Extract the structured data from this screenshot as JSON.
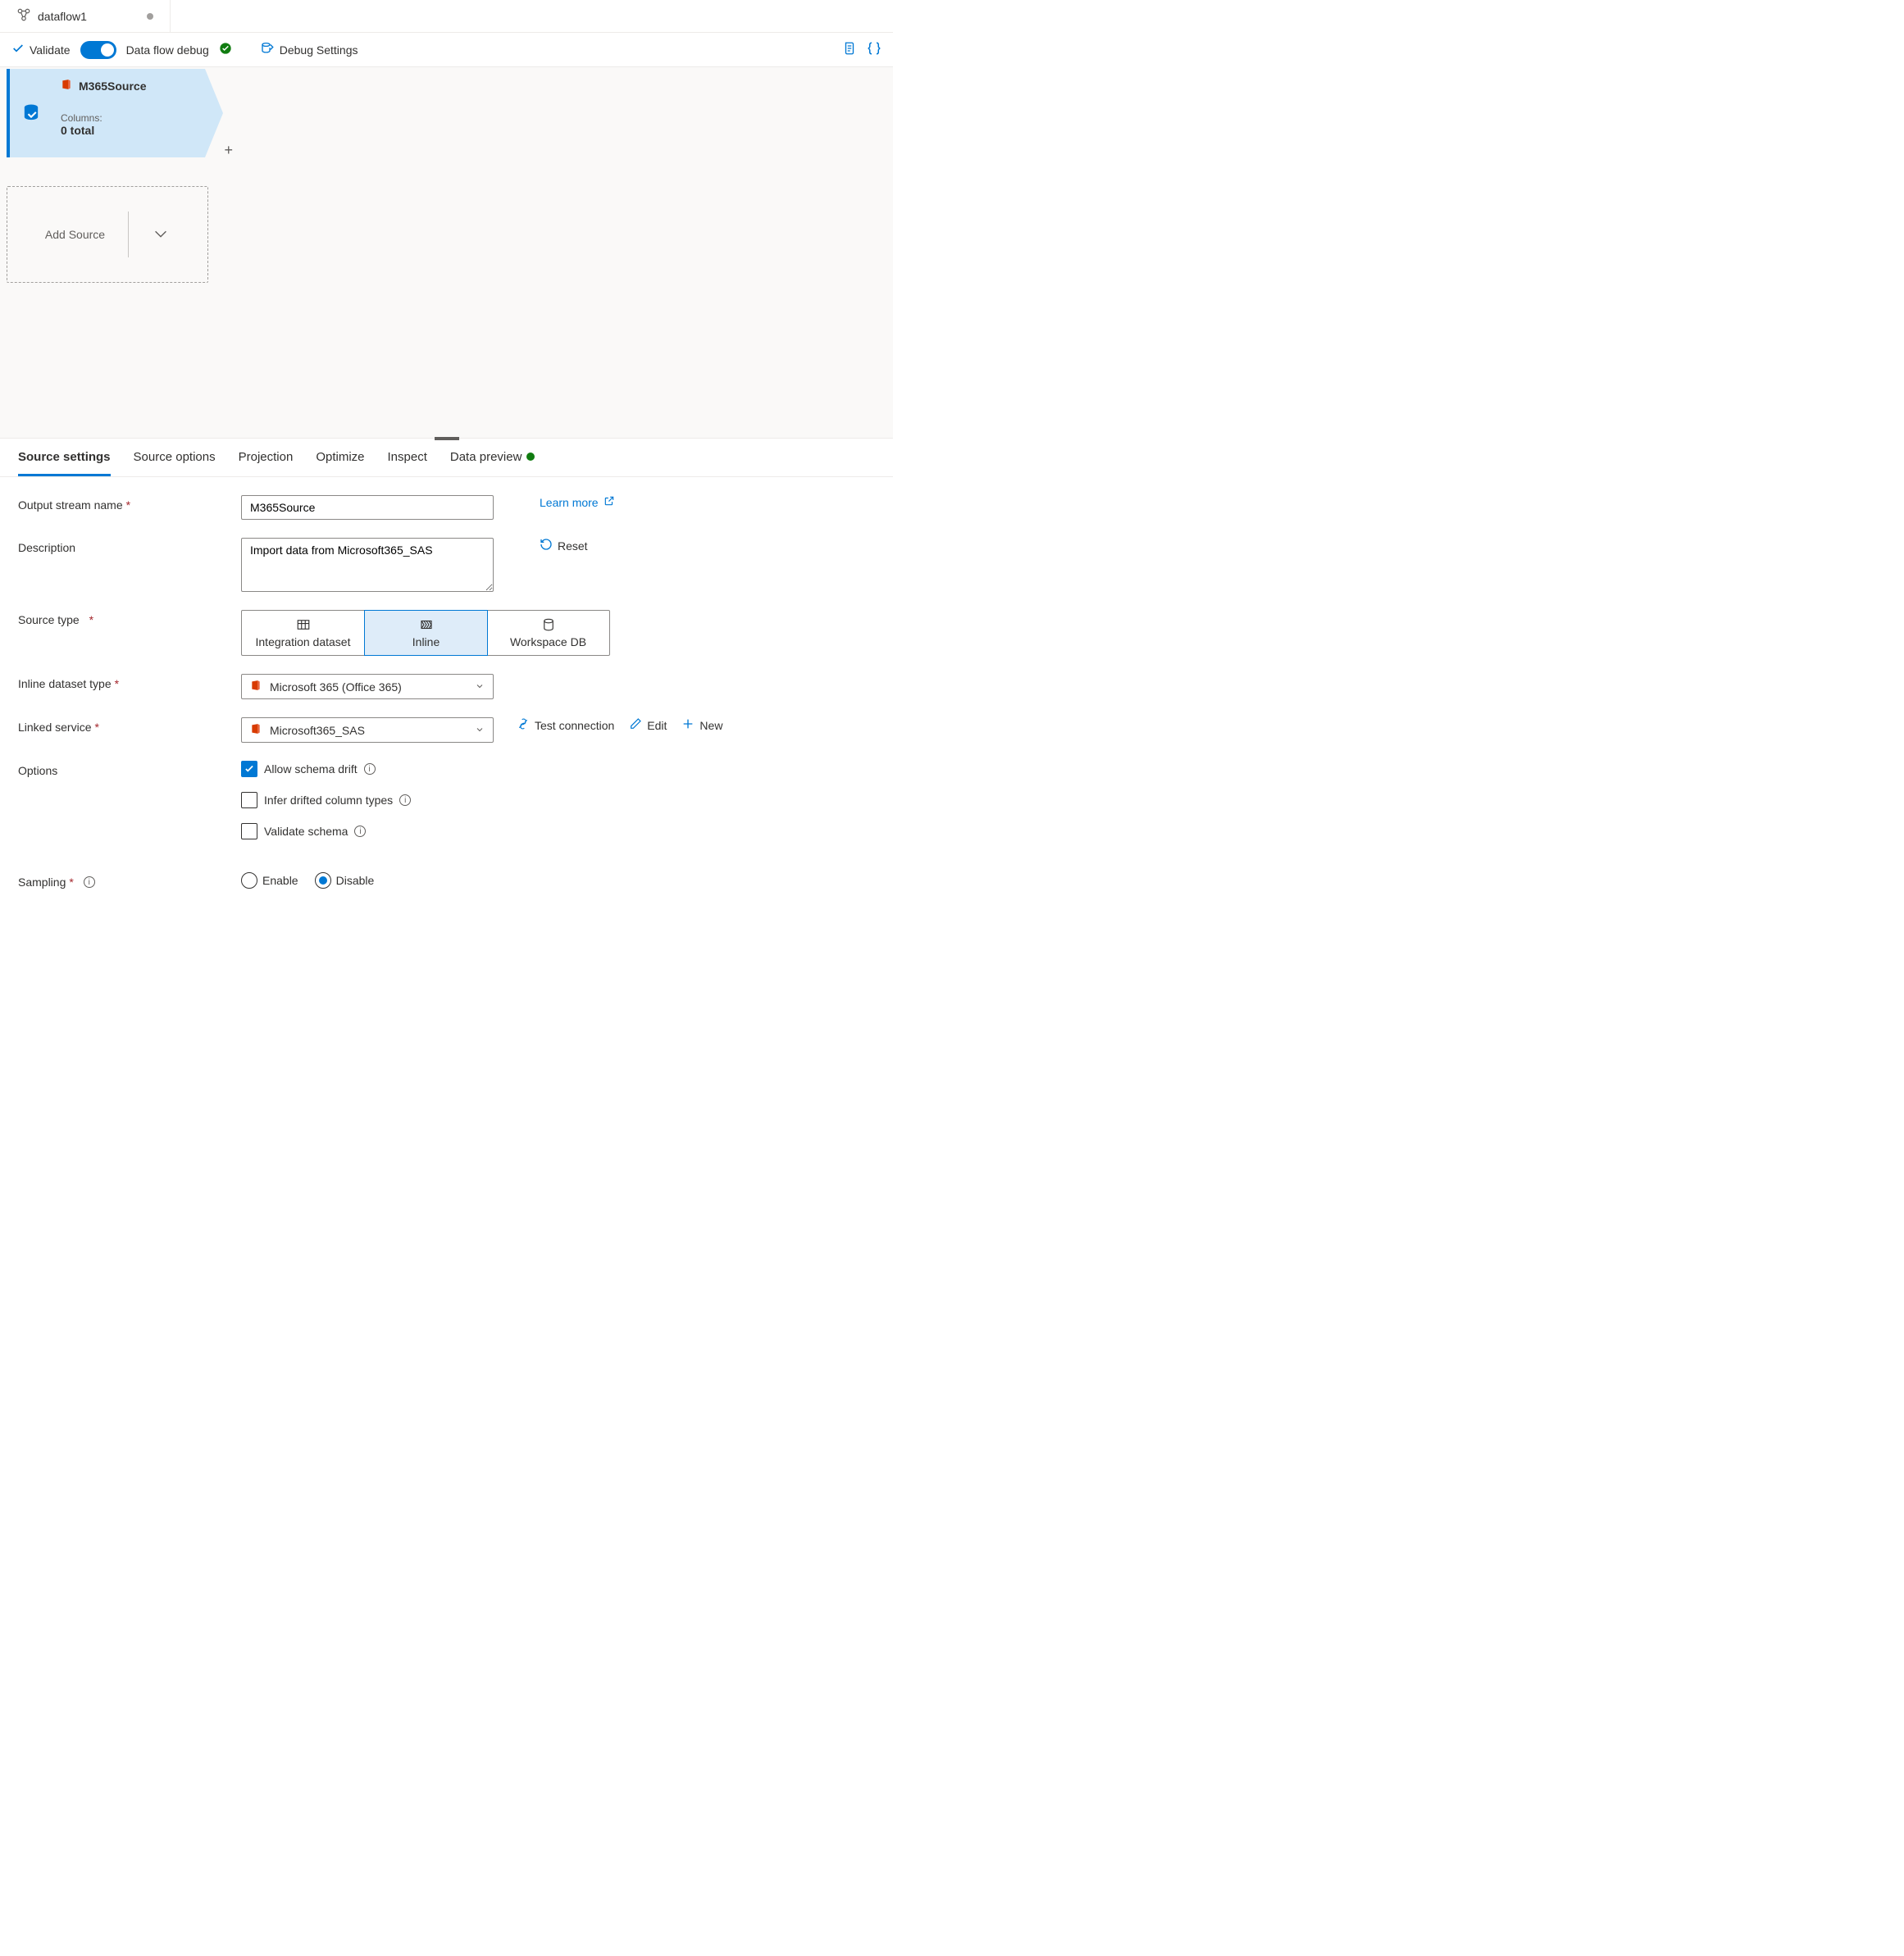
{
  "tab": {
    "title": "dataflow1"
  },
  "toolbar": {
    "validate": "Validate",
    "debug_label": "Data flow debug",
    "debug_settings": "Debug Settings"
  },
  "node": {
    "name": "M365Source",
    "columns_label": "Columns:",
    "columns_count": "0 total"
  },
  "add_source": "Add Source",
  "panel_tabs": {
    "source_settings": "Source settings",
    "source_options": "Source options",
    "projection": "Projection",
    "optimize": "Optimize",
    "inspect": "Inspect",
    "data_preview": "Data preview"
  },
  "form": {
    "output_stream_label": "Output stream name",
    "output_stream_value": "M365Source",
    "learn_more": "Learn more",
    "description_label": "Description",
    "description_value": "Import data from Microsoft365_SAS",
    "reset": "Reset",
    "source_type_label": "Source type",
    "source_type": {
      "integration": "Integration dataset",
      "inline": "Inline",
      "workspace": "Workspace DB"
    },
    "inline_type_label": "Inline dataset type",
    "inline_type_value": "Microsoft 365 (Office 365)",
    "linked_service_label": "Linked service",
    "linked_service_value": "Microsoft365_SAS",
    "test_connection": "Test connection",
    "edit": "Edit",
    "new": "New",
    "options_label": "Options",
    "allow_drift": "Allow schema drift",
    "infer_drifted": "Infer drifted column types",
    "validate_schema": "Validate schema",
    "sampling_label": "Sampling",
    "enable": "Enable",
    "disable": "Disable"
  }
}
